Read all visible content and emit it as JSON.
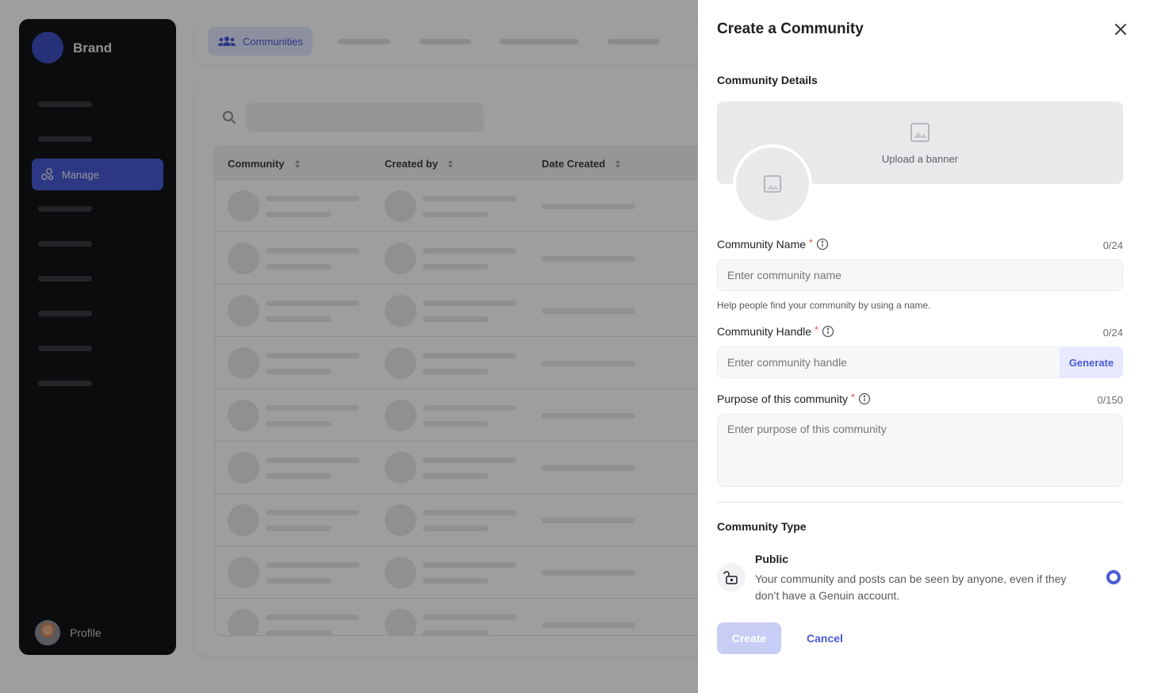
{
  "brand": {
    "name": "Brand"
  },
  "sidebar": {
    "active_item": "Manage",
    "profile_label": "Profile"
  },
  "topbar": {
    "active_tab": "Communities"
  },
  "table": {
    "columns": [
      "Community",
      "Created by",
      "Date Created"
    ]
  },
  "drawer": {
    "title": "Create a Community",
    "details_title": "Community Details",
    "banner_label": "Upload a banner",
    "name": {
      "label": "Community Name",
      "counter": "0/24",
      "placeholder": "Enter community name",
      "help": "Help people find your community by using a name."
    },
    "handle": {
      "label": "Community Handle",
      "counter": "0/24",
      "placeholder": "Enter community handle",
      "generate_label": "Generate"
    },
    "purpose": {
      "label": "Purpose of this community",
      "counter": "0/150",
      "placeholder": "Enter purpose of this community"
    },
    "type": {
      "title": "Community Type",
      "option_title": "Public",
      "option_desc": "Your community and posts can be seen by anyone, even if they don’t have a Genuin account."
    },
    "create_label": "Create",
    "cancel_label": "Cancel"
  },
  "colors": {
    "accent": "#4a5bd6",
    "sidebar_bg": "#131416",
    "required": "#e8453c"
  },
  "icons": [
    "manage-icon",
    "community-icon",
    "search-icon",
    "sort-icon",
    "close-icon",
    "image-icon",
    "info-icon",
    "unlock-icon"
  ]
}
